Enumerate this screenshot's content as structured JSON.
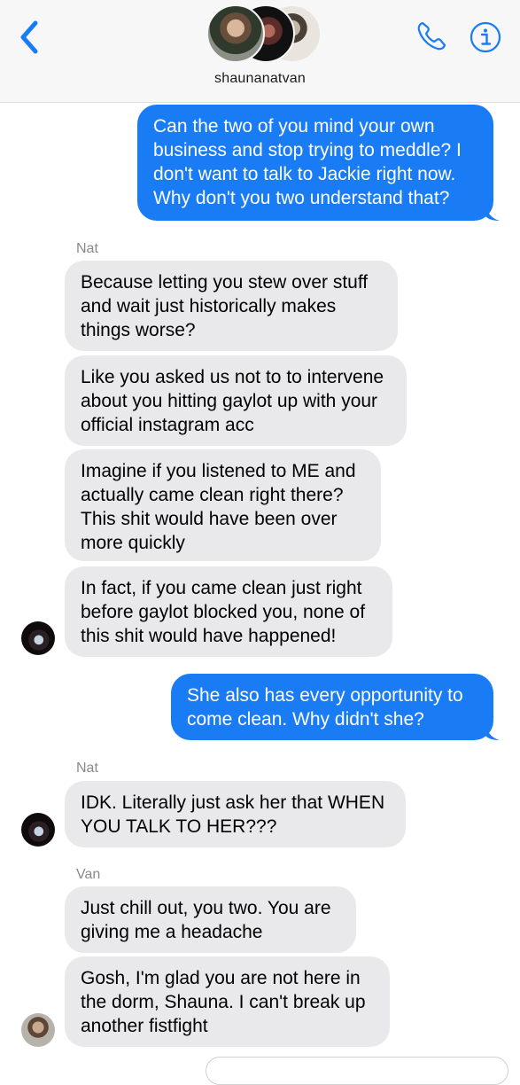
{
  "header": {
    "group_name": "shaunanatvan"
  },
  "colors": {
    "accent": "#1a7cf5",
    "outgoing_bubble": "#1a7cf5",
    "incoming_bubble": "#e9e9eb",
    "sender_label": "#8a8a8e"
  },
  "icons": {
    "back": "chevron-left-icon",
    "call": "phone-icon",
    "details": "info-icon"
  },
  "messages": [
    {
      "direction": "outgoing",
      "text": "Can the two of you mind your own business and stop trying to meddle? I don't want to talk to Jackie right now. Why don't you two understand that?"
    },
    {
      "direction": "incoming",
      "sender": "Nat",
      "text": "Because letting you stew over stuff and wait just historically makes things worse?"
    },
    {
      "direction": "incoming",
      "sender": "Nat",
      "text": "Like you asked us not to to intervene about you hitting gaylot up with your official instagram acc"
    },
    {
      "direction": "incoming",
      "sender": "Nat",
      "text": "Imagine if you listened to ME and actually came clean right there? This shit would have been over more quickly"
    },
    {
      "direction": "incoming",
      "sender": "Nat",
      "text": "In fact, if you came clean just right before gaylot blocked you, none of this shit would have happened!"
    },
    {
      "direction": "outgoing",
      "text": "She also has every opportunity to come clean. Why didn't she?"
    },
    {
      "direction": "incoming",
      "sender": "Nat",
      "text": "IDK. Literally just ask her that WHEN YOU TALK TO HER???"
    },
    {
      "direction": "incoming",
      "sender": "Van",
      "text": "Just chill out, you two. You are giving me a headache"
    },
    {
      "direction": "incoming",
      "sender": "Van",
      "text": "Gosh, I'm glad you are not here in the dorm, Shauna. I can't break up another fistfight"
    }
  ]
}
